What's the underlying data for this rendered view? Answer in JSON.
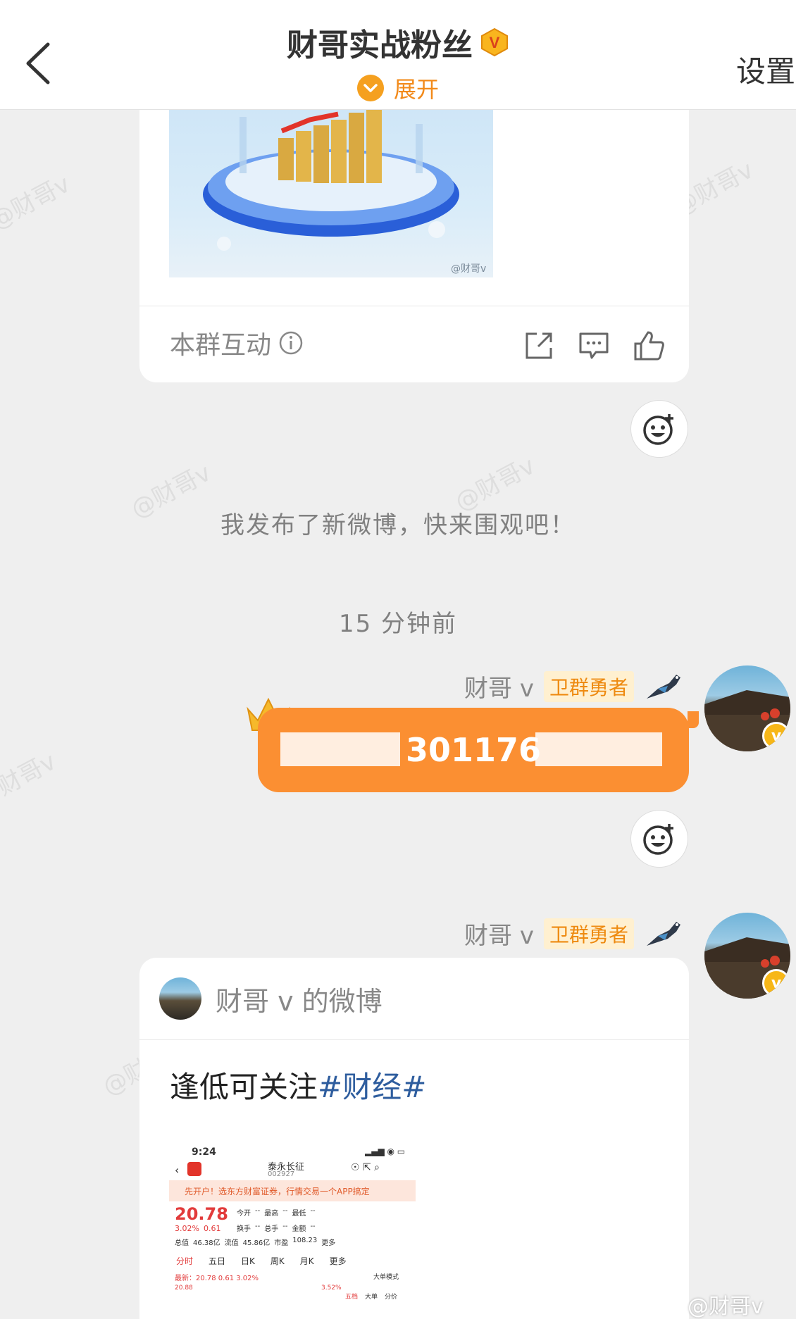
{
  "header": {
    "title": "财哥实战粉丝",
    "expand_label": "展开",
    "settings_label": "设置"
  },
  "watermark": "@财哥v",
  "post_card": {
    "image_watermark": "@财哥v",
    "footer_label": "本群互动"
  },
  "system_message": "我发布了新微博，快来围观吧！",
  "time_divider": "15 分钟前",
  "messages": [
    {
      "sender": "财哥 v",
      "role": "卫群勇者",
      "text_visible": "301176"
    },
    {
      "sender": "财哥 v",
      "role": "卫群勇者"
    }
  ],
  "weibo_card": {
    "source": "财哥 v 的微博",
    "text": "逢低可关注",
    "hashtag": "#财经#"
  },
  "stock_screenshot": {
    "time": "9:24",
    "name": "泰永长征",
    "code": "002927",
    "banner": "先开户！选东方财富证券，行情交易一个APP搞定",
    "price": "20.78",
    "pct": "3.02%",
    "change": "0.61",
    "labels": {
      "open": "今开",
      "high": "最高",
      "low": "最低",
      "turnover": "换手",
      "volume": "总手",
      "amount": "金额"
    },
    "total_value_label": "总值",
    "total_value": "46.38亿",
    "float_label": "流值",
    "float_value": "45.86亿",
    "pe_label": "市盈",
    "pe_value": "108.23",
    "more": "更多",
    "tabs": [
      "分时",
      "五日",
      "日K",
      "周K",
      "月K",
      "更多"
    ],
    "latest_line": "最新：20.78  0.61  3.02%",
    "mode": "大单模式",
    "axis_top": "20.88",
    "axis_pct": "3.52%",
    "sub_tabs": [
      "五档",
      "大单",
      "分价"
    ]
  },
  "footer_watermark": "@财哥v"
}
